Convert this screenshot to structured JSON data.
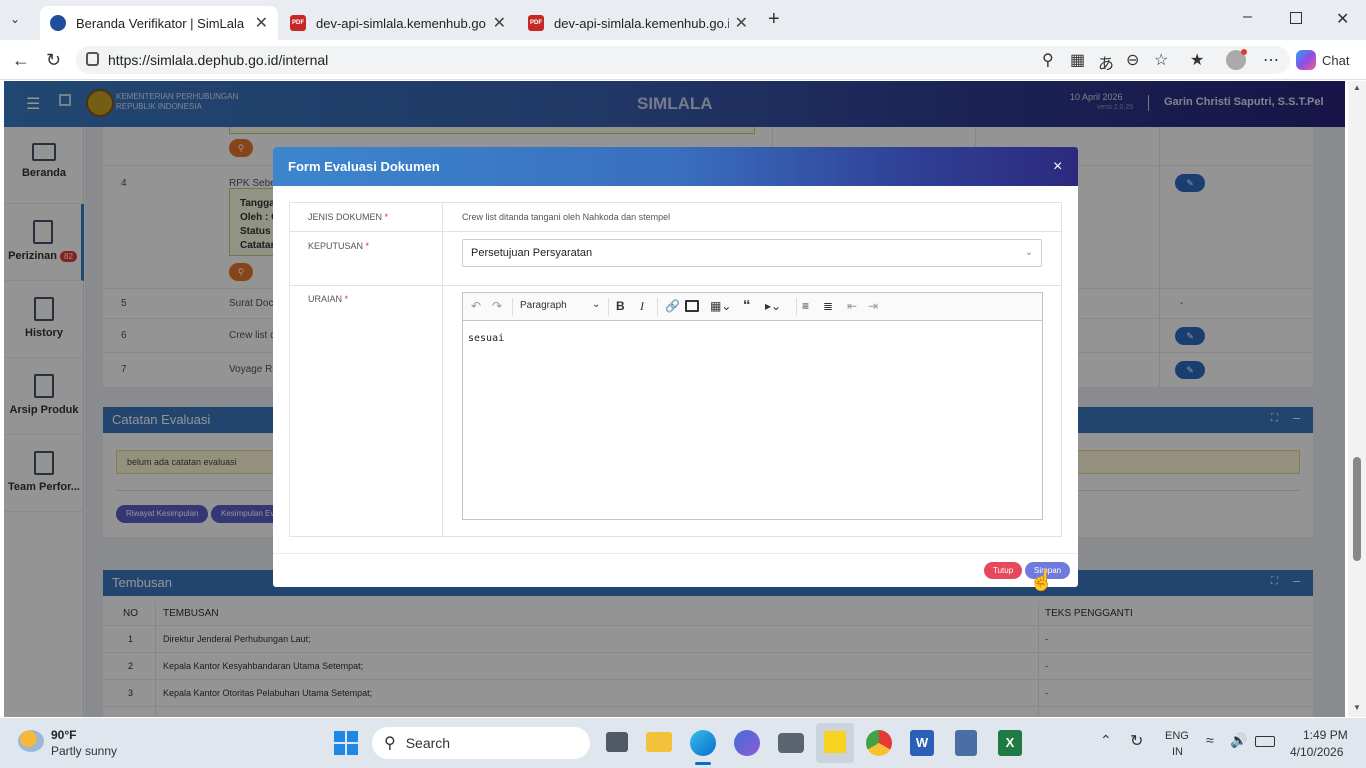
{
  "browser": {
    "tabs": [
      {
        "title": "Beranda Verifikator | SimLala",
        "active": true
      },
      {
        "title": "dev-api-simlala.kemenhub.go.id/api",
        "active": false
      },
      {
        "title": "dev-api-simlala.kemenhub.go.id/api",
        "active": false
      }
    ],
    "url": "https://simlala.dephub.go.id/internal",
    "chat_label": "Chat"
  },
  "header": {
    "org_line1": "KEMENTERIAN PERHUBUNGAN",
    "org_line2": "REPUBLIK INDONESIA",
    "app_title": "SIMLALA",
    "date": "10 April 2026",
    "version": "versi 2.0.25",
    "user": "Garin Christi Saputri, S.S.T.Pel"
  },
  "sidebar": {
    "items": [
      {
        "label": "Beranda",
        "icon": "monitor-icon"
      },
      {
        "label": "Perizinan",
        "icon": "document-icon",
        "badge": "82"
      },
      {
        "label": "History",
        "icon": "document-icon"
      },
      {
        "label": "Arsip Produk",
        "icon": "document-icon"
      },
      {
        "label": "Team Perfor...",
        "icon": "document-icon"
      }
    ]
  },
  "docs_table": {
    "rows": [
      {
        "no": "4",
        "name": "RPK Sebelu",
        "detail_1": "Tangga",
        "detail_2": "Oleh : C",
        "detail_3": "Status :",
        "detail_4": "Catatan"
      },
      {
        "no": "5",
        "name": "Surat Dock",
        "action": "-"
      },
      {
        "no": "6",
        "name": "Crew list d"
      },
      {
        "no": "7",
        "name": "Voyage Re"
      }
    ]
  },
  "catatan": {
    "title": "Catatan Evaluasi",
    "empty_text": "belum ada catatan evaluasi",
    "btn_riwayat": "Riwayat Kesimpulan",
    "btn_kesimpulan": "Kesimpulan Ev"
  },
  "tembusan": {
    "title": "Tembusan",
    "col_no": "NO",
    "col_tembusan": "TEMBUSAN",
    "col_teks": "TEKS PENGGANTI",
    "rows": [
      {
        "no": "1",
        "name": "Direktur Jenderal Perhubungan Laut;",
        "teks": "-"
      },
      {
        "no": "2",
        "name": "Kepala Kantor Kesyahbandaran Utama Setempat;",
        "teks": "-"
      },
      {
        "no": "3",
        "name": "Kepala Kantor Otoritas Pelabuhan Utama Setempat;",
        "teks": "-"
      }
    ]
  },
  "modal": {
    "title": "Form Evaluasi Dokumen",
    "close": "×",
    "jenis_label": "JENIS DOKUMEN",
    "jenis_value": "Crew list ditanda tangani oleh Nahkoda dan stempel",
    "keputusan_label": "KEPUTUSAN",
    "keputusan_value": "Persetujuan Persyaratan",
    "uraian_label": "URAIAN",
    "editor_heading": "Paragraph",
    "editor_content": "sesuai",
    "btn_tutup": "Tutup",
    "btn_simpan": "Simpan",
    "required_mark": "*"
  },
  "taskbar": {
    "weather_temp": "90°F",
    "weather_desc": "Partly sunny",
    "search_placeholder": "Search",
    "lang_1": "ENG",
    "lang_2": "IN",
    "time": "1:49 PM",
    "date": "4/10/2026"
  },
  "colors": {
    "header_start": "#3a7cc4",
    "header_end": "#2a237a",
    "accent_blue": "#3b78c0",
    "pill": "#5b5fc7",
    "tutup": "#e8485c",
    "simpan": "#6f7bdc"
  }
}
